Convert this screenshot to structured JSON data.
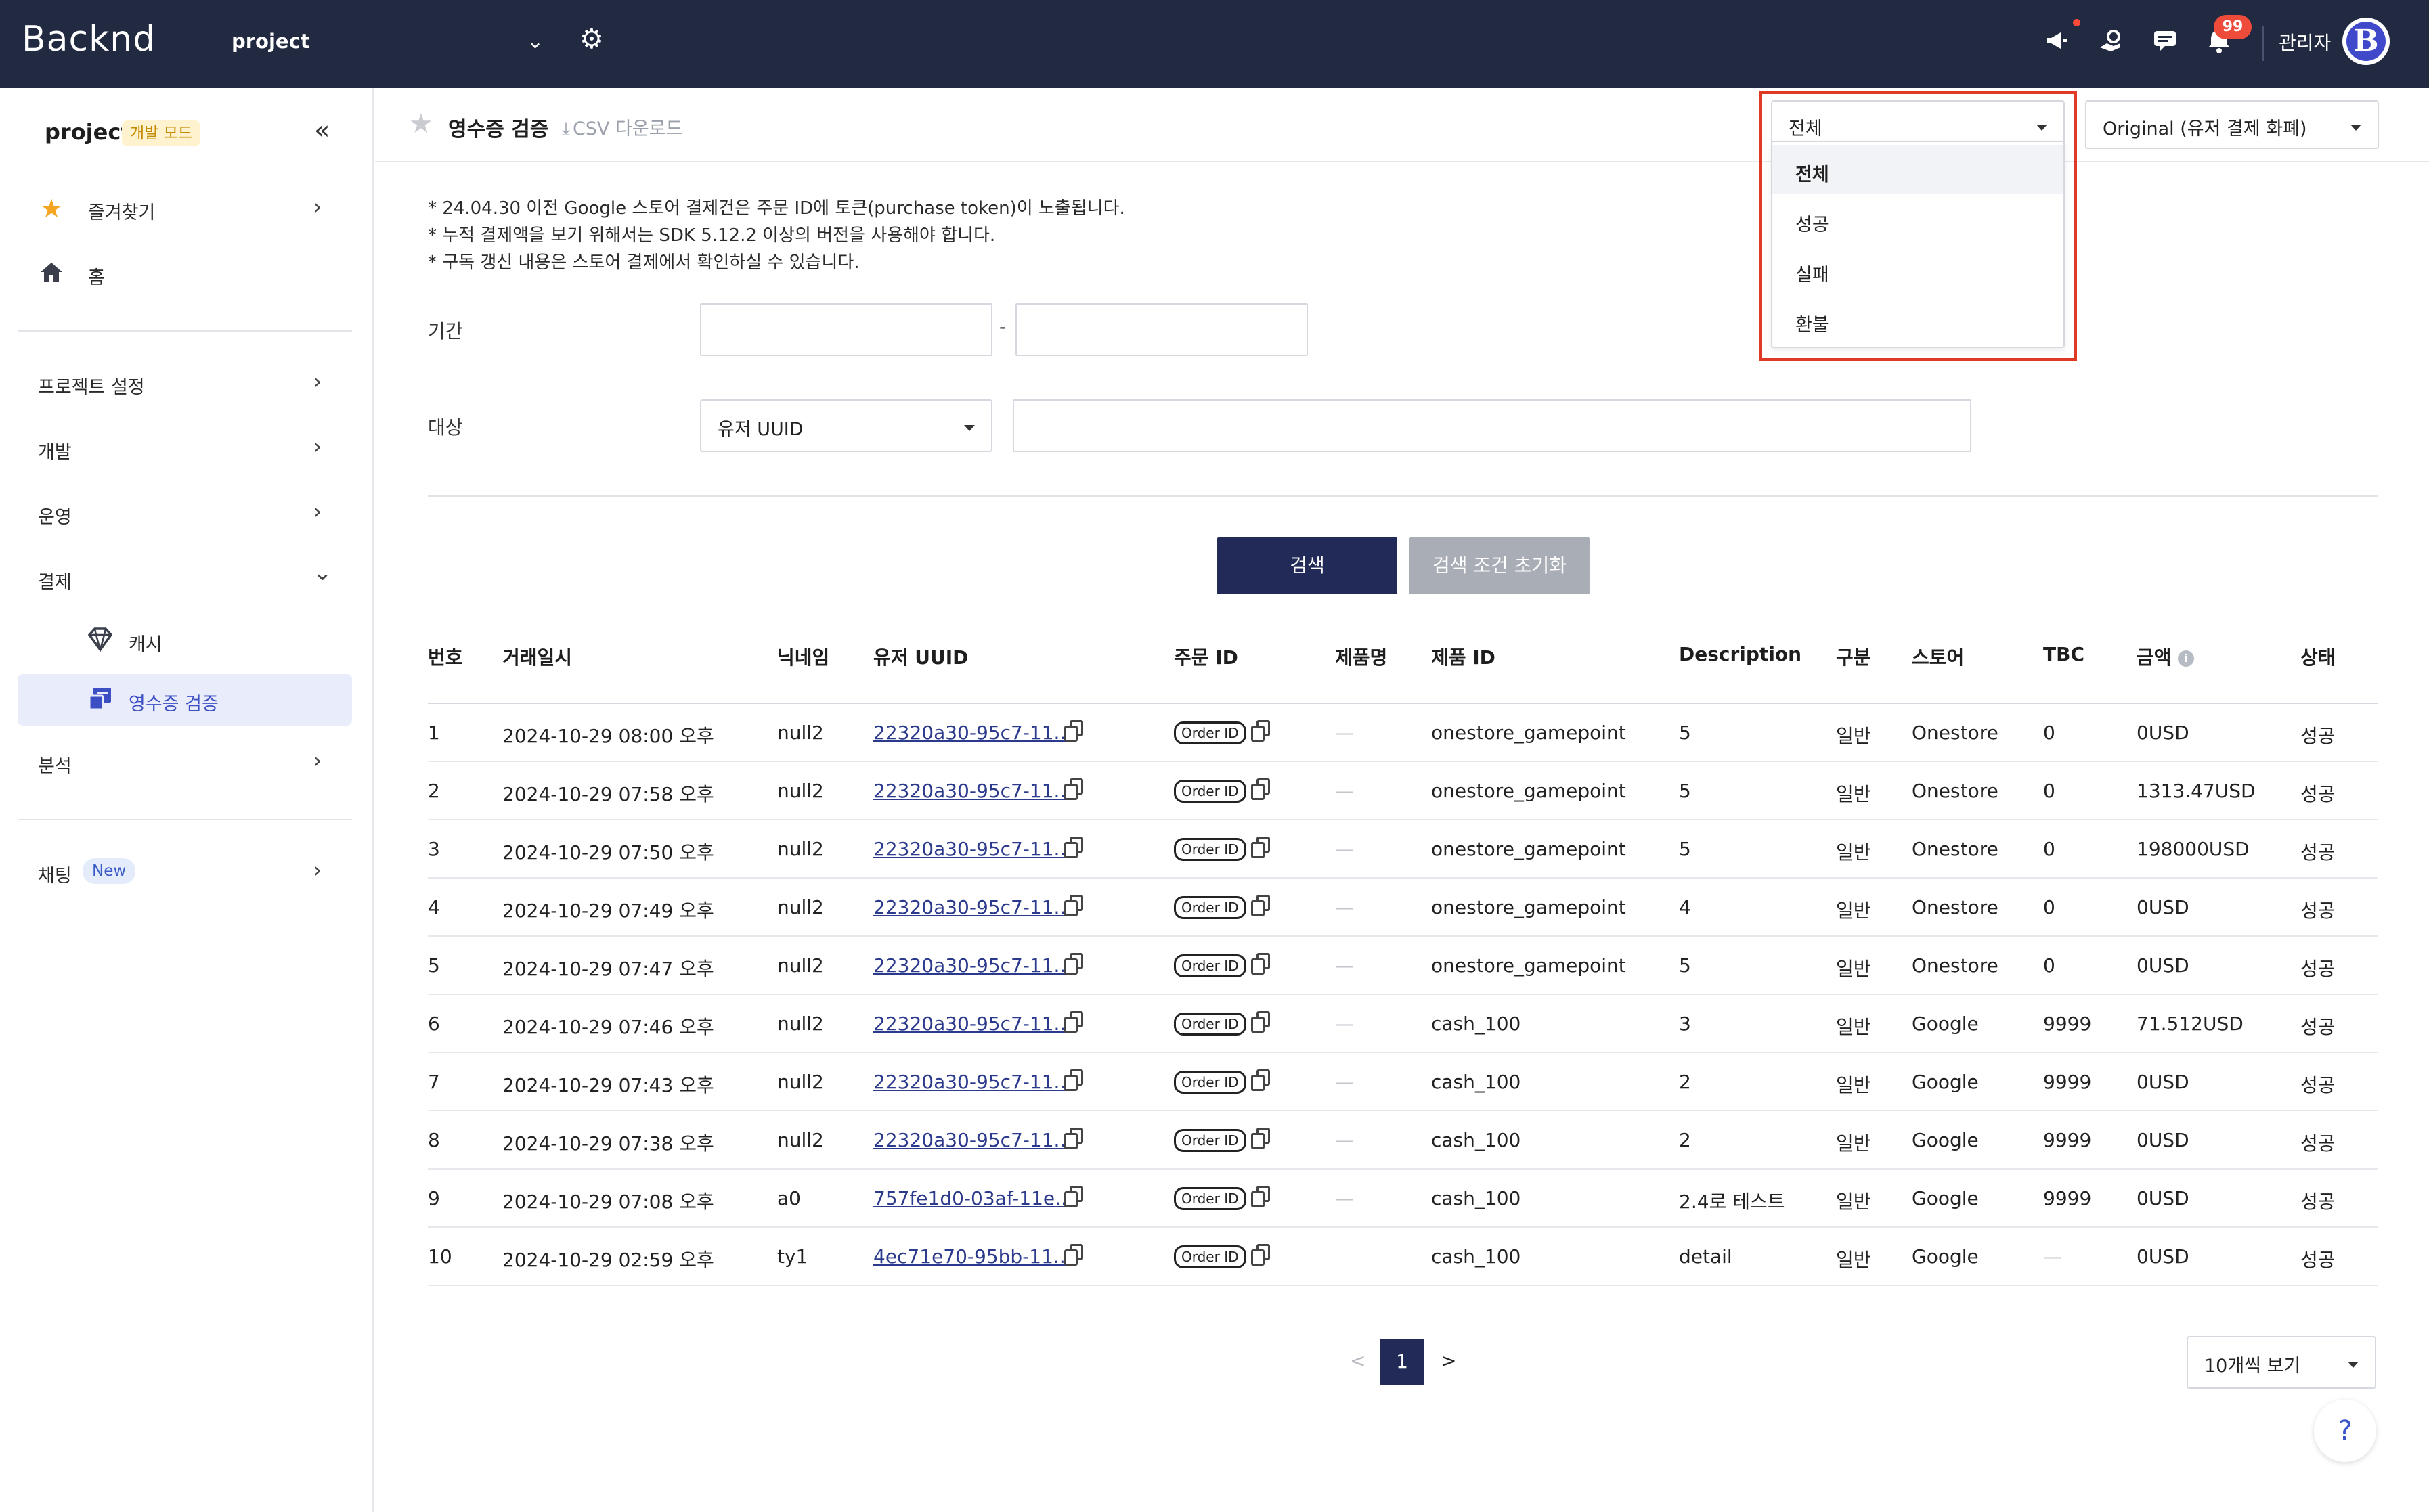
{
  "app": {
    "logo": "Backnd",
    "project_select": "project",
    "admin_label": "관리자",
    "avatar_letter": "B",
    "notification_count": "99",
    "accent": "#222a57",
    "topbar_color": "#222a41"
  },
  "sidebar": {
    "title": "project",
    "mode_badge": "개발 모드",
    "items": [
      {
        "label": "즐겨찾기",
        "icon": "star-icon"
      },
      {
        "label": "홈",
        "icon": "home-icon"
      },
      {
        "label": "프로젝트 설정"
      },
      {
        "label": "개발"
      },
      {
        "label": "운영"
      },
      {
        "label": "결제"
      },
      {
        "label": "분석"
      },
      {
        "label": "채팅",
        "badge": "New"
      }
    ],
    "sub_items": [
      {
        "label": "캐시",
        "icon": "diamond-icon"
      },
      {
        "label": "영수증 검증",
        "icon": "receipt-icon",
        "active": true
      }
    ]
  },
  "header": {
    "title": "영수증 검증",
    "csv": "CSV 다운로드",
    "status_filter": "전체",
    "view_select": "Original (유저 결제 화폐)"
  },
  "status_dropdown": {
    "options": [
      "전체",
      "성공",
      "실패",
      "환불"
    ],
    "selected": "전체"
  },
  "notes": [
    "* 24.04.30 이전 Google 스토어 결제건은 주문 ID에 토큰(purchase token)이 노출됩니다.",
    "* 누적 결제액을 보기 위해서는 SDK 5.12.2 이상의 버전을 사용해야 합니다.",
    "* 구독 갱신 내용은 스토어 결제에서 확인하실 수 있습니다."
  ],
  "form": {
    "period_label": "기간",
    "period_dash": "-",
    "target_label": "대상",
    "target_select": "유저 UUID",
    "search_button": "검색",
    "reset_button": "검색 조건 초기화"
  },
  "table": {
    "headers": [
      "번호",
      "거래일시",
      "닉네임",
      "유저 UUID",
      "주문 ID",
      "제품명",
      "제품 ID",
      "Description",
      "구분",
      "스토어",
      "TBC",
      "금액",
      "상태"
    ],
    "order_badge": "Order ID",
    "rows": [
      {
        "no": "1",
        "date": "2024-10-29 08:00 오후",
        "nick": "null2",
        "uuid": "22320a30-95c7-11...",
        "pname": "—",
        "pid": "onestore_gamepoint",
        "desc": "5",
        "type": "일반",
        "store": "Onestore",
        "tbc": "0",
        "amount": "0USD",
        "status": "성공"
      },
      {
        "no": "2",
        "date": "2024-10-29 07:58 오후",
        "nick": "null2",
        "uuid": "22320a30-95c7-11...",
        "pname": "—",
        "pid": "onestore_gamepoint",
        "desc": "5",
        "type": "일반",
        "store": "Onestore",
        "tbc": "0",
        "amount": "1313.47USD",
        "status": "성공"
      },
      {
        "no": "3",
        "date": "2024-10-29 07:50 오후",
        "nick": "null2",
        "uuid": "22320a30-95c7-11...",
        "pname": "—",
        "pid": "onestore_gamepoint",
        "desc": "5",
        "type": "일반",
        "store": "Onestore",
        "tbc": "0",
        "amount": "198000USD",
        "status": "성공"
      },
      {
        "no": "4",
        "date": "2024-10-29 07:49 오후",
        "nick": "null2",
        "uuid": "22320a30-95c7-11...",
        "pname": "—",
        "pid": "onestore_gamepoint",
        "desc": "4",
        "type": "일반",
        "store": "Onestore",
        "tbc": "0",
        "amount": "0USD",
        "status": "성공"
      },
      {
        "no": "5",
        "date": "2024-10-29 07:47 오후",
        "nick": "null2",
        "uuid": "22320a30-95c7-11...",
        "pname": "—",
        "pid": "onestore_gamepoint",
        "desc": "5",
        "type": "일반",
        "store": "Onestore",
        "tbc": "0",
        "amount": "0USD",
        "status": "성공"
      },
      {
        "no": "6",
        "date": "2024-10-29 07:46 오후",
        "nick": "null2",
        "uuid": "22320a30-95c7-11...",
        "pname": "—",
        "pid": "cash_100",
        "desc": "3",
        "type": "일반",
        "store": "Google",
        "tbc": "9999",
        "amount": "71.512USD",
        "status": "성공"
      },
      {
        "no": "7",
        "date": "2024-10-29 07:43 오후",
        "nick": "null2",
        "uuid": "22320a30-95c7-11...",
        "pname": "—",
        "pid": "cash_100",
        "desc": "2",
        "type": "일반",
        "store": "Google",
        "tbc": "9999",
        "amount": "0USD",
        "status": "성공"
      },
      {
        "no": "8",
        "date": "2024-10-29 07:38 오후",
        "nick": "null2",
        "uuid": "22320a30-95c7-11...",
        "pname": "—",
        "pid": "cash_100",
        "desc": "2",
        "type": "일반",
        "store": "Google",
        "tbc": "9999",
        "amount": "0USD",
        "status": "성공"
      },
      {
        "no": "9",
        "date": "2024-10-29 07:08 오후",
        "nick": "a0",
        "uuid": "757fe1d0-03af-11e...",
        "pname": "—",
        "pid": "cash_100",
        "desc": "2.4로 테스트",
        "type": "일반",
        "store": "Google",
        "tbc": "9999",
        "amount": "0USD",
        "status": "성공"
      },
      {
        "no": "10",
        "date": "2024-10-29 02:59 오후",
        "nick": "ty1",
        "uuid": "4ec71e70-95bb-11...",
        "pname": "",
        "pid": "cash_100",
        "desc": "detail",
        "type": "일반",
        "store": "Google",
        "tbc": "—",
        "amount": "0USD",
        "status": "성공"
      }
    ]
  },
  "pagination": {
    "prev": "<",
    "current": "1",
    "next": ">",
    "page_size": "10개씩 보기"
  },
  "help": "?"
}
